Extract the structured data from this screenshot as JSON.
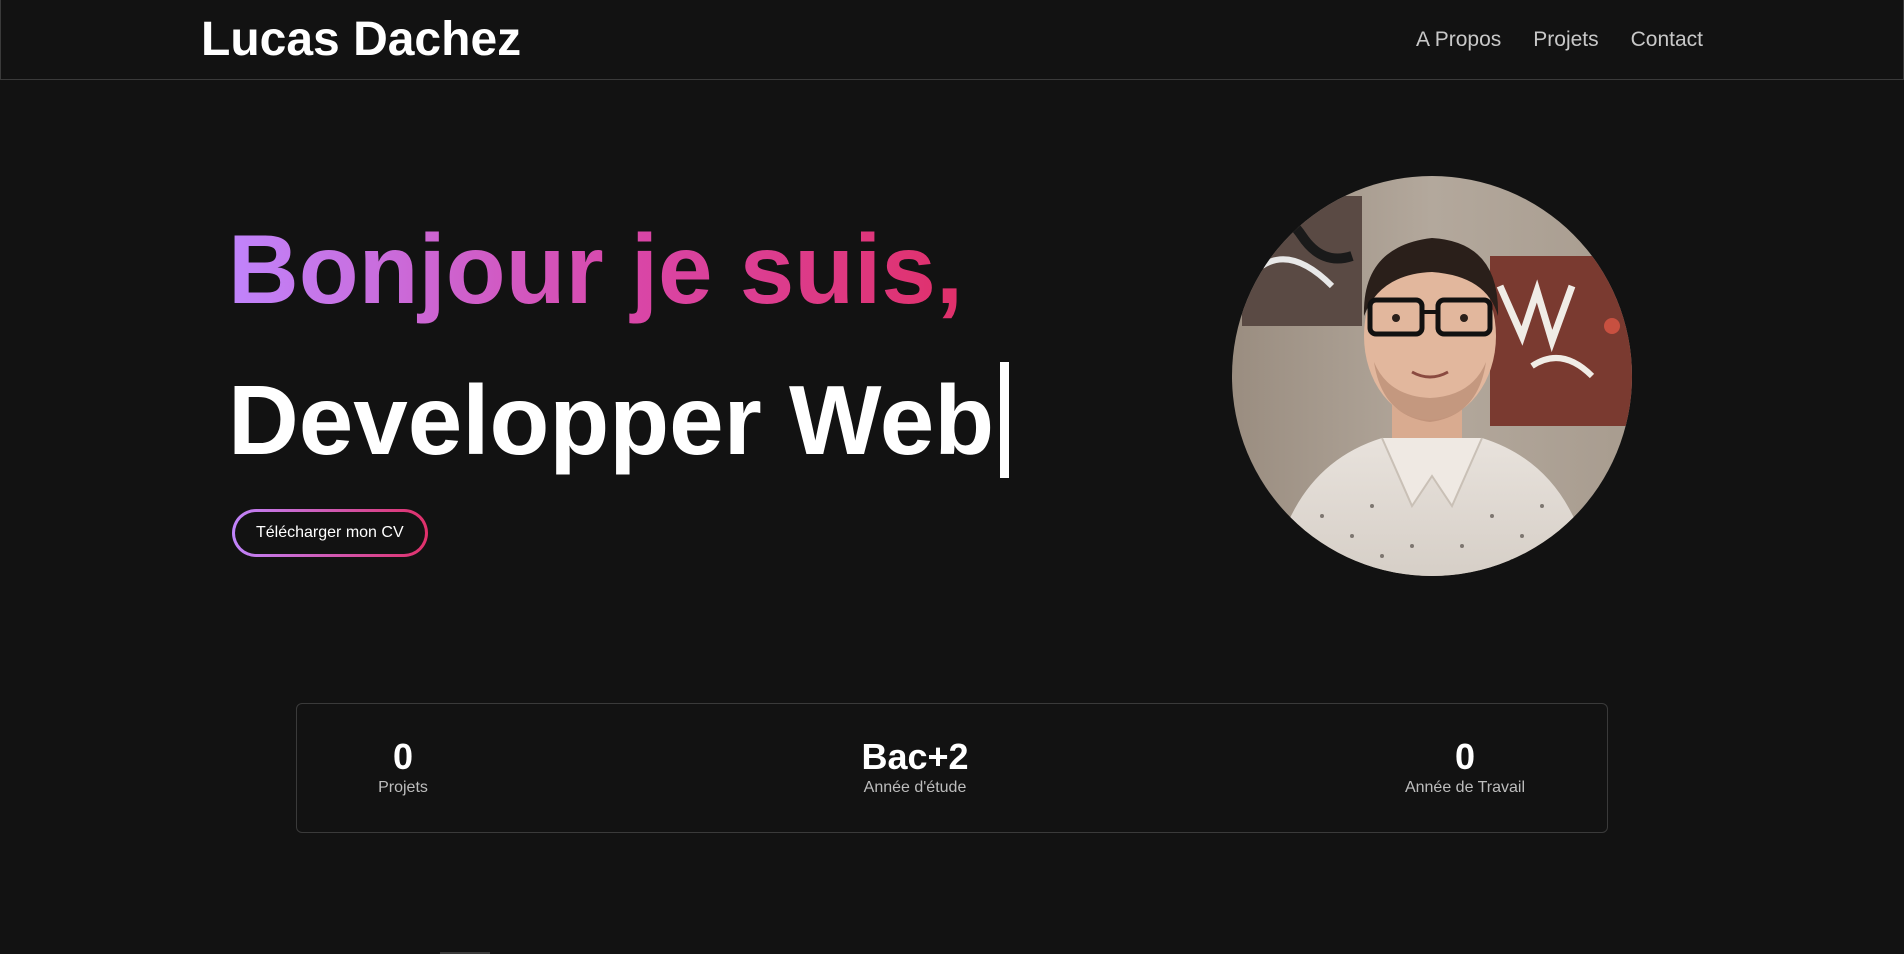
{
  "header": {
    "brand": "Lucas Dachez",
    "nav": [
      {
        "label": "A Propos"
      },
      {
        "label": "Projets"
      },
      {
        "label": "Contact"
      }
    ]
  },
  "hero": {
    "greeting": "Bonjour je suis,",
    "role": "Developper Web",
    "cv_button": "Télécharger mon CV",
    "gradient_colors": [
      "#c084fc",
      "#d946a8",
      "#e0306a"
    ]
  },
  "stats": [
    {
      "value": "0",
      "label": "Projets"
    },
    {
      "value": "Bac+2",
      "label": "Année d'étude"
    },
    {
      "value": "0",
      "label": "Année de Travail"
    }
  ]
}
